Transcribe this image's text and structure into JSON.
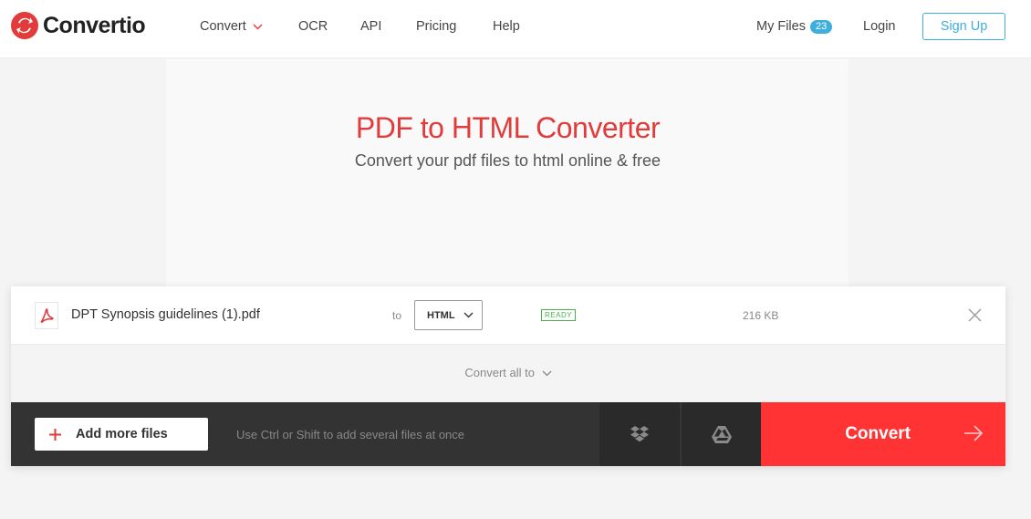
{
  "app": {
    "brand": "Convertio"
  },
  "nav": {
    "items": [
      {
        "label": "Convert",
        "has_dropdown": true
      },
      {
        "label": "OCR"
      },
      {
        "label": "API"
      },
      {
        "label": "Pricing"
      },
      {
        "label": "Help"
      }
    ],
    "my_files_label": "My Files",
    "my_files_count": "23",
    "login_label": "Login",
    "signup_label": "Sign Up"
  },
  "hero": {
    "title": "PDF to HTML Converter",
    "subtitle": "Convert your pdf files to html online & free"
  },
  "file": {
    "name": "DPT Synopsis guidelines (1).pdf",
    "to_label": "to",
    "format": "HTML",
    "status": "READY",
    "size": "216 KB"
  },
  "convert_all": {
    "label": "Convert all to"
  },
  "toolbar": {
    "add_label": "Add more files",
    "hint": "Use Ctrl or Shift to add several files at once",
    "convert_label": "Convert"
  },
  "colors": {
    "brand_red": "#e23b3b",
    "convert_red": "#ff3333",
    "accent_blue": "#3eaede",
    "ready_green": "#4caf50",
    "bar_dark": "#333333"
  },
  "icons": [
    "convertio-logo-icon",
    "chevron-down-icon",
    "pdf-file-icon",
    "close-icon",
    "plus-icon",
    "dropbox-icon",
    "google-drive-icon",
    "arrow-right-icon"
  ]
}
